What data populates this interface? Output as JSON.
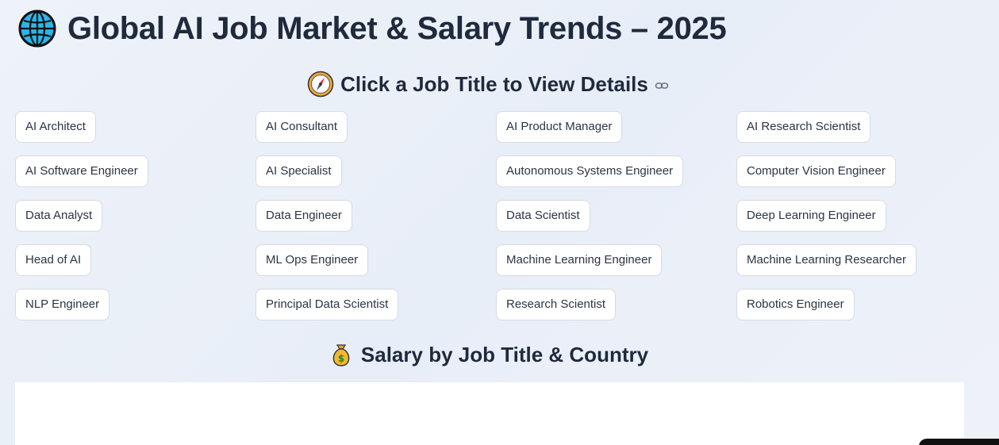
{
  "header": {
    "title": "Global AI Job Market & Salary Trends – 2025",
    "icon": "globe-icon"
  },
  "jobs_section": {
    "heading": "Click a Job Title to View Details",
    "icon": "compass-icon",
    "anchor_icon": "link-icon",
    "job_titles": [
      "AI Architect",
      "AI Consultant",
      "AI Product Manager",
      "AI Research Scientist",
      "AI Software Engineer",
      "AI Specialist",
      "Autonomous Systems Engineer",
      "Computer Vision Engineer",
      "Data Analyst",
      "Data Engineer",
      "Data Scientist",
      "Deep Learning Engineer",
      "Head of AI",
      "ML Ops Engineer",
      "Machine Learning Engineer",
      "Machine Learning Researcher",
      "NLP Engineer",
      "Principal Data Scientist",
      "Research Scientist",
      "Robotics Engineer"
    ]
  },
  "salary_section": {
    "heading": "Salary by Job Title & Country",
    "icon": "money-bag-icon"
  },
  "colors": {
    "text": "#1f2a3c",
    "button_border": "#d6dae2",
    "background": "#eef2f9"
  }
}
